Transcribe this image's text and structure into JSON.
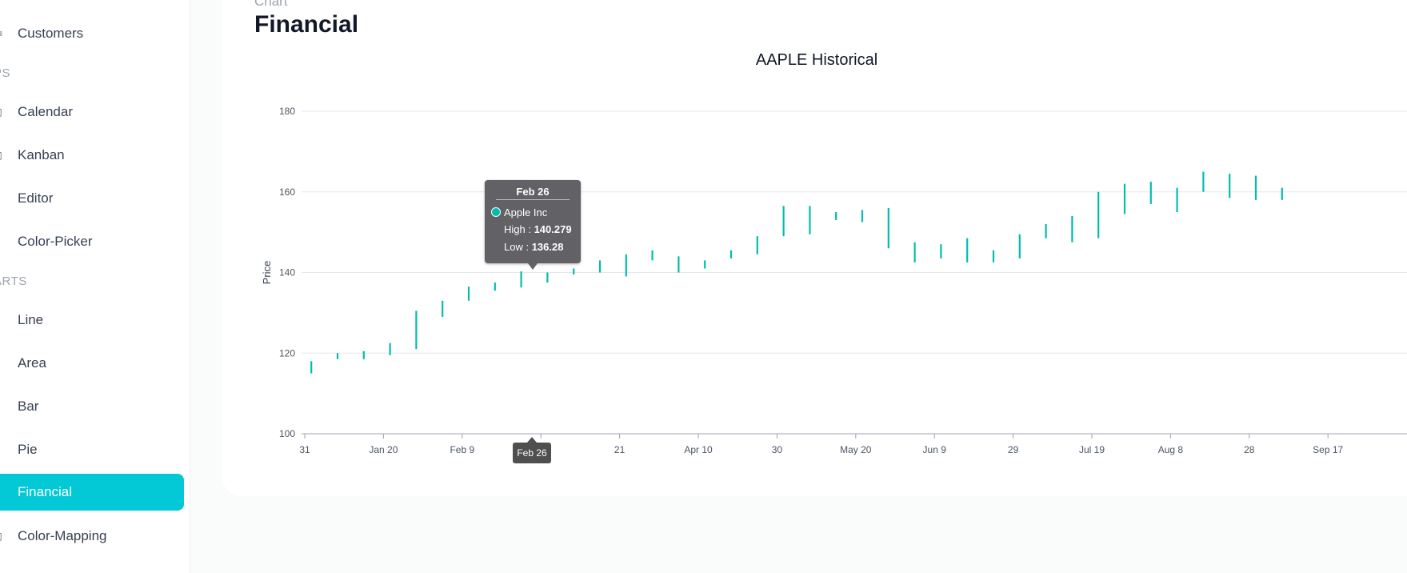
{
  "sidebar": {
    "sections": [
      {
        "title": "PS"
      },
      {
        "title": "ARTS"
      }
    ],
    "items": [
      {
        "label": "Customers",
        "icon": "table-icon"
      },
      {
        "label": "Calendar",
        "icon": "calendar-icon"
      },
      {
        "label": "Kanban",
        "icon": "kanban-icon"
      },
      {
        "label": "Editor",
        "icon": "pen-icon"
      },
      {
        "label": "Color-Picker",
        "icon": "palette-icon"
      },
      {
        "label": "Line",
        "icon": "line-chart-icon"
      },
      {
        "label": "Area",
        "icon": "area-chart-icon"
      },
      {
        "label": "Bar",
        "icon": "bar-chart-icon"
      },
      {
        "label": "Pie",
        "icon": "pie-chart-icon"
      },
      {
        "label": "Financial",
        "icon": "stock-chart-icon",
        "active": true
      },
      {
        "label": "Color-Mapping",
        "icon": "color-map-icon"
      }
    ],
    "active_color": "#03c9d7"
  },
  "main": {
    "breadcrumb": "Chart",
    "title": "Financial"
  },
  "tooltip": {
    "header": "Feb 26",
    "series": "Apple Inc",
    "high_label": "High : ",
    "high_value": "140.279",
    "low_label": "Low : ",
    "low_value": "136.28"
  },
  "crosshair_label": "Feb 26",
  "chart_data": {
    "type": "hilo",
    "title": "AAPLE Historical",
    "ylabel": "Price",
    "xlabel": "",
    "ylim": [
      100,
      180
    ],
    "yticks": [
      100,
      120,
      140,
      160,
      180
    ],
    "xticks": [
      "31",
      "Jan 20",
      "Feb 9",
      "",
      "21",
      "Apr 10",
      "30",
      "May 20",
      "Jun 9",
      "29",
      "Jul 19",
      "Aug 8",
      "28",
      "Sep 17"
    ],
    "xtick_label_positions": [
      0,
      3,
      6,
      9,
      12,
      15,
      18,
      21,
      24,
      27,
      30,
      33,
      36,
      39
    ],
    "grid": true,
    "color": "#00bdae",
    "series": [
      {
        "name": "Apple Inc",
        "high": [
          118,
          120,
          120.5,
          122.5,
          130.5,
          133,
          136.5,
          137.5,
          140.279,
          140,
          141,
          143,
          144.5,
          145.5,
          144,
          143,
          145.5,
          149,
          156.5,
          156.5,
          155,
          155.5,
          156,
          147.5,
          147,
          148.5,
          145.5,
          149.5,
          152,
          154,
          160,
          162,
          162.5,
          161,
          165,
          164.5,
          164,
          161
        ],
        "low": [
          115,
          118.5,
          118.5,
          119.5,
          121,
          129,
          133,
          135.5,
          136.28,
          137.5,
          139.5,
          140,
          139,
          143,
          140,
          141,
          143.5,
          144.5,
          149,
          149.5,
          153,
          152.5,
          146,
          142.5,
          143.5,
          142.5,
          142.5,
          143.5,
          148.5,
          147.5,
          148.5,
          154.5,
          157,
          155,
          160,
          158.5,
          158,
          158
        ]
      }
    ],
    "categories_count": 40,
    "first_category_index": 0
  }
}
